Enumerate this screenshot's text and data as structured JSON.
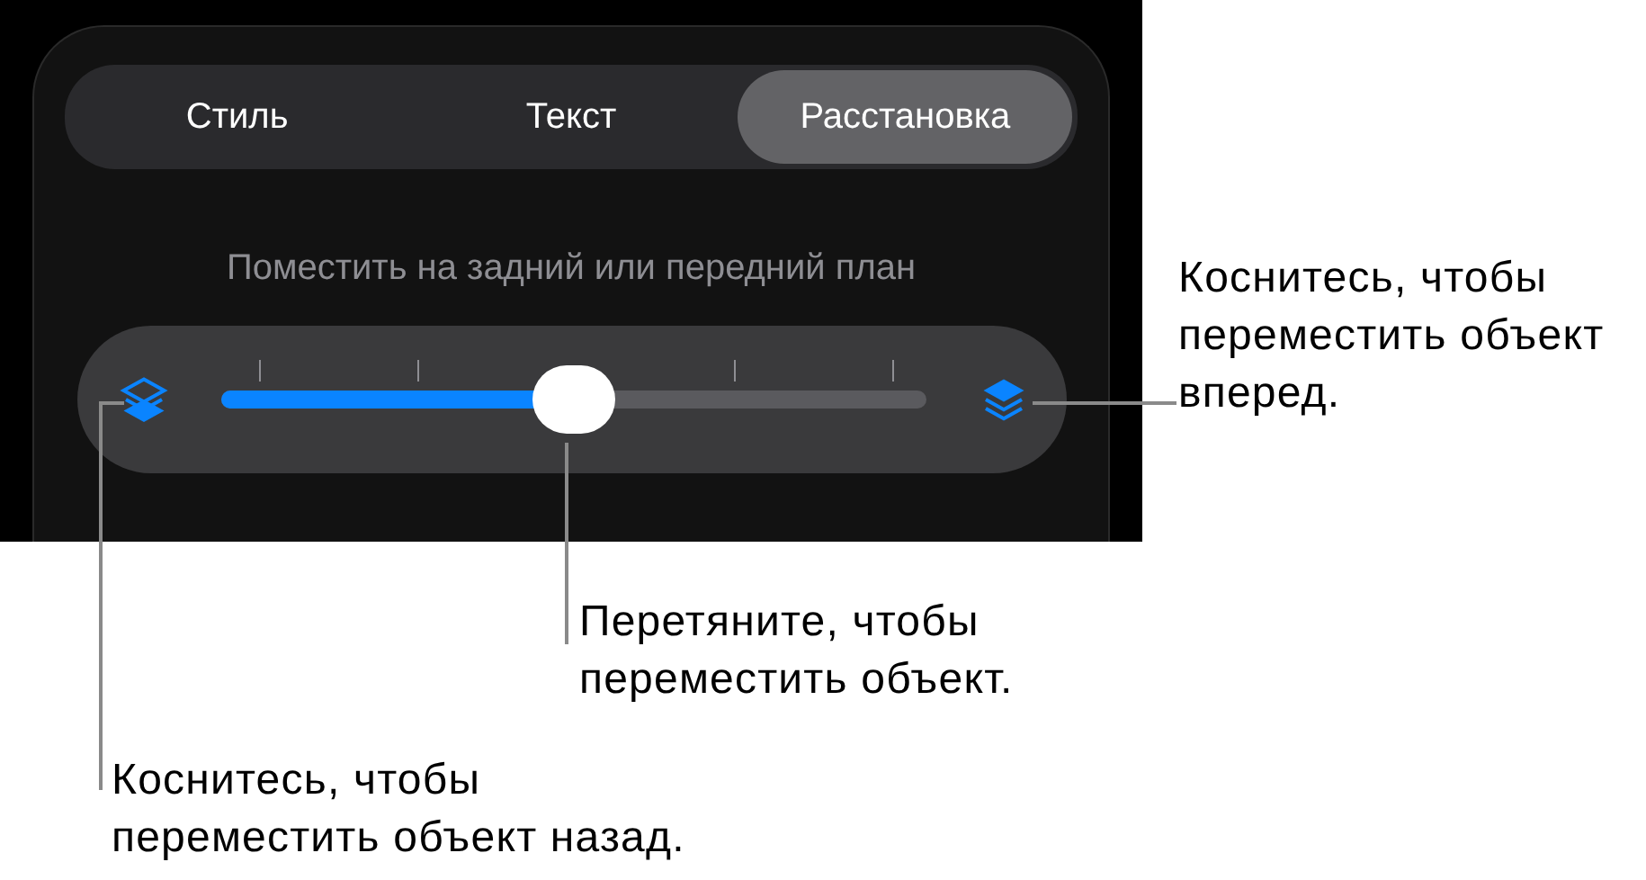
{
  "tabs": [
    {
      "label": "Стиль",
      "selected": false
    },
    {
      "label": "Текст",
      "selected": false
    },
    {
      "label": "Расстановка",
      "selected": true
    }
  ],
  "section_label": "Поместить на задний или передний план",
  "slider": {
    "level": 0.5
  },
  "callouts": [
    {
      "kind": "right",
      "text": "Коснитесь, чтобы переместить объект вперед."
    },
    {
      "kind": "middle",
      "text": "Перетяните, чтобы переместить объект."
    },
    {
      "kind": "left",
      "text": "Коснитесь, чтобы переместить объект назад."
    }
  ]
}
